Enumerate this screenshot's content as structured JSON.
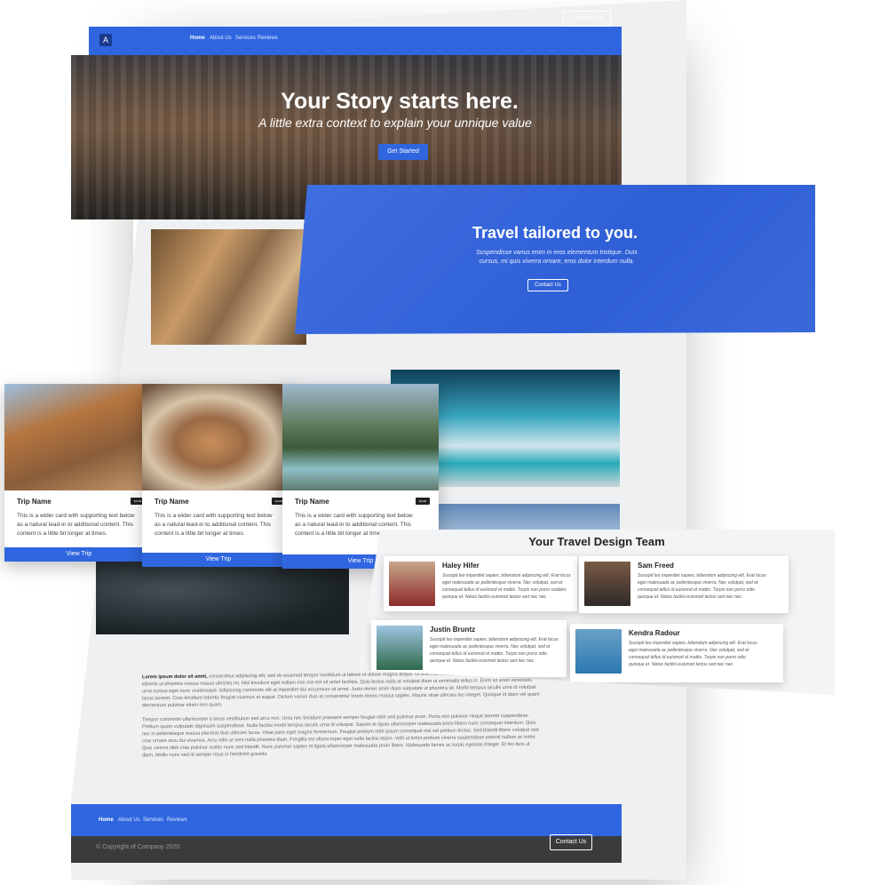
{
  "nav": {
    "items": [
      "Home",
      "About Us",
      "Services",
      "Reviews"
    ],
    "contact_label": "Contact Us"
  },
  "hero": {
    "title": "Your Story starts here.",
    "subtitle": "A little extra context to explain your unnique value",
    "button_label": "Get Started"
  },
  "travel": {
    "title": "Travel tailored to you.",
    "body": "Suspendisse varius enim in eros elementum tristique. Duis cursus, mi quis viverra ornare, eros dolor interdum nulla.",
    "button_label": "Contact Us"
  },
  "cards": [
    {
      "title": "Trip Name",
      "badge": "$1499",
      "text": "This is a wider card with supporting text below as a natural lead-in to additional content. This content is a little bit longer at times.",
      "button_label": "View Trip"
    },
    {
      "title": "Trip Name",
      "badge": "$1499",
      "text": "This is a wider card with supporting text below as a natural lead-in to additional content. This content is a little bit longer at times.",
      "button_label": "View Trip"
    },
    {
      "title": "Trip Name",
      "badge": "$1499",
      "text": "This is a wider card with supporting text below as a natural lead-in to additional content. This content is a little bit longer at times.",
      "button_label": "View Trip"
    }
  ],
  "team": {
    "title": "Your Travel Design Team",
    "members": [
      {
        "name": "Haley Hifer",
        "bio": "Suscipit leo imperdiet sapien, bibendum adipiscing elit. Erat locus eget malesuada ac pellentesque viverra. Nec volutpat, sed et consequat tellus id euismod et mattis. Turpis non porro sodales quisque et. Netus facilisi euismod lectus sed nec nec."
      },
      {
        "name": "Sam Freed",
        "bio": "Suscipit leo imperdiet sapien, bibendum adipiscing elit. Erat locus eget malesuada ac pellentesque viverra. Nec volutpat, sed et consequat tellus id euismod et mattis. Turpis non porro odio quisque et. Netus facilisi euismod lectus sed nec nec."
      },
      {
        "name": "Justin Bruntz",
        "bio": "Suscipit leo imperdiet sapien, bibendum adipiscing elit. Erat locus eget malesuada ac pellentesque viverra. Nec volutpat, sed et consequat tellus id euismod et mattis. Turpis non porro odio quisque et. Netus facilisi euismod lectus sed nec nec."
      },
      {
        "name": "Kendra Radour",
        "bio": "Suscipit leo imperdiet sapien, bibendum adipiscing elit. Erat locus eget malesuada ac pellentesque viverra. Nec volutpat, sed et consequat tellus id euismod et mattis. Turpis non porro odio quisque et. Netus facilisi euismod lectus sed nec nec."
      }
    ]
  },
  "body_text": {
    "lead": "Lorem ipsum dolor sit amet,",
    "para1": "consectetur adipiscing elit, sed do eiusmod tempor incididunt ut labore et dolore magna aliqua. Ut enim ad minim veniam mauris et magna id felis. Cras lobortis ut pharetra massa massa ultricies mi. Nisl tincidunt eget nullam non nisi est sit amet facilisis. Quis lectus nulla at volutpat diam ut venenatis tellus in. Enim sit amet venenatis urna cursus eget nunc scelerisque. Adipiscing commodo elit at imperdiet dui accumsan sit amet. Justo donec enim diam vulputate ut pharetra sit. Morbi tempus iaculis urna id volutpat lacus laoreet. Cras tincidunt lobortis feugiat vivamus at augue. Dictum varius duis at consectetur lorem donec massa sapien. Mauris vitae ultricies leo integer. Quisque id diam vel quam elementum pulvinar etiam non quam.",
    "para2": "Tempor commodo ullamcorper a lacus vestibulum sed arcu non. Urna nec tincidunt praesent semper feugiat nibh sed pulvinar proin. Porta non pulvinar neque laoreet suspendisse. Pretium quam vulputate dignissim suspendisse. Nulla facilisi morbi tempus iaculis urna id volutpat. Sapien et ligula ullamcorper malesuada proin libero nunc consequat interdum. Quis nec in pellentesque massa placerat duis ultricies lacus. Vitae justo eget magna fermentum. Feugiat pretium nibh ipsum consequat nisl vel pretium lectus. Sed blandit libero volutpat sed cras ornare arcu dui vivamus. Arcu odio ut sem nulla pharetra diam. Fringilla est ullamcorper eget nulla facilisi etiam. Velit ut tortor pretium viverra suspendisse potenti nullam ac tortor. Quis viverra nibh cras pulvinar mattis nunc sed blandit. Nunc pulvinar sapien et ligula ullamcorper malesuada proin libero. Malesuada fames ac turpis egestas integer. Et leo duis ut diam. Mollis nunc sed id semper risus in hendrerit gravida."
  },
  "footer": {
    "items": [
      "Home",
      "About Us",
      "Services",
      "Reviews"
    ],
    "contact_label": "Contact Us",
    "copyright": "© Copyright of Company 2020"
  },
  "colors": {
    "accent": "#2f66e0",
    "footer_dark": "#3a3b3d"
  }
}
